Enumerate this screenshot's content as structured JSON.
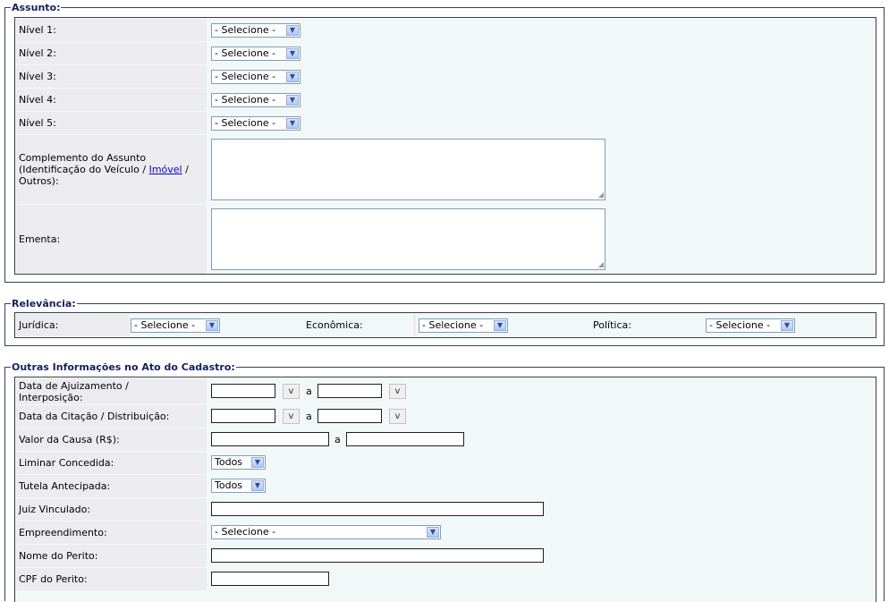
{
  "assunto": {
    "legend": "Assunto:",
    "levels": [
      {
        "label": "Nível 1:",
        "selected": "- Selecione -"
      },
      {
        "label": "Nível 2:",
        "selected": "- Selecione -"
      },
      {
        "label": "Nível 3:",
        "selected": "- Selecione -"
      },
      {
        "label": "Nível 4:",
        "selected": "- Selecione -"
      },
      {
        "label": "Nível 5:",
        "selected": "- Selecione -"
      }
    ],
    "complemento_line1": "Complemento do Assunto",
    "complemento_line2_pre": "(Identificação do Veículo / ",
    "complemento_link": "Imóvel",
    "complemento_line2_post": " /",
    "complemento_line3": "Outros):",
    "ementa_label": "Ementa:"
  },
  "relevancia": {
    "legend": "Relevância:",
    "juridica_label": "Jurídica:",
    "juridica_selected": "- Selecione -",
    "economica_label": "Econômica:",
    "economica_selected": "- Selecione -",
    "politica_label": "Política:",
    "politica_selected": "- Selecione -"
  },
  "outras": {
    "legend": "Outras Informações no Ato do Cadastro:",
    "data_ajuizamento_line1": "Data de Ajuizamento /",
    "data_ajuizamento_line2": "Interposição:",
    "data_citacao_label": "Data da Citação / Distribuição:",
    "range_sep": "a",
    "calendar_button": "v",
    "valor_causa_label": "Valor da Causa (R$):",
    "liminar_label": "Liminar Concedida:",
    "liminar_selected": "Todos",
    "tutela_label": "Tutela Antecipada:",
    "tutela_selected": "Todos",
    "juiz_label": "Juiz Vinculado:",
    "empreendimento_label": "Empreendimento:",
    "empreendimento_selected": "- Selecione -",
    "nome_perito_label": "Nome do Perito:",
    "cpf_perito_label": "CPF do Perito:"
  }
}
